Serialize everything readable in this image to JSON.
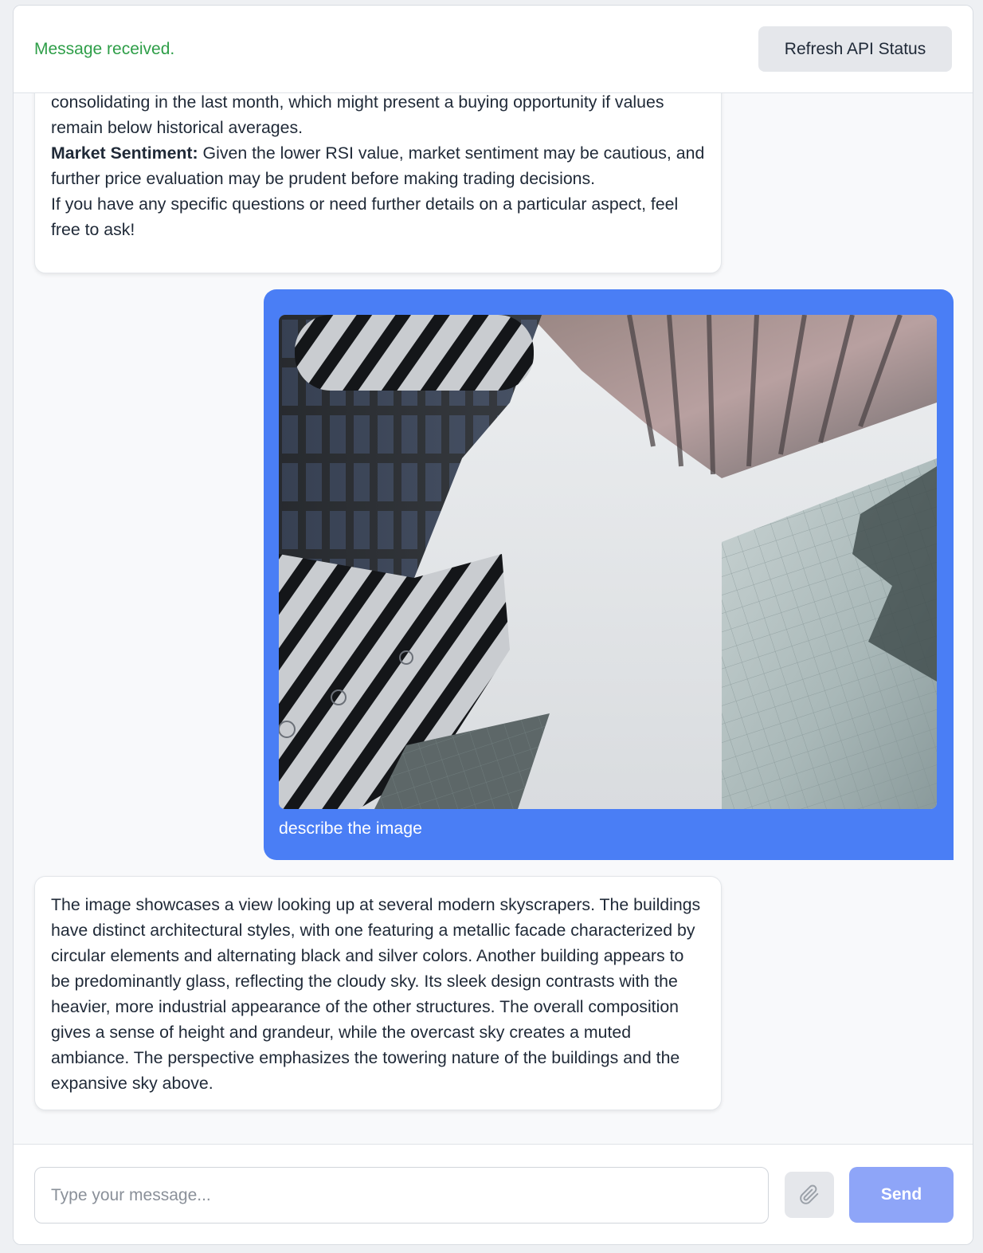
{
  "header": {
    "status": "Message received.",
    "refresh_label": "Refresh API Status"
  },
  "messages": [
    {
      "role": "assistant",
      "paragraphs": [
        {
          "text": "consolidating in the last month, which might present a buying opportunity if values remain below historical averages."
        },
        {
          "bold": "Market Sentiment:",
          "text": " Given the lower RSI value, market sentiment may be cautious, and further price evaluation may be prudent before making trading decisions."
        },
        {
          "text": "If you have any specific questions or need further details on a particular aspect, feel free to ask!"
        }
      ]
    },
    {
      "role": "user",
      "image_subject": "low-angle view of modern skyscrapers",
      "text": "describe the image"
    },
    {
      "role": "assistant",
      "text": "The image showcases a view looking up at several modern skyscrapers. The buildings have distinct architectural styles, with one featuring a metallic facade characterized by circular elements and alternating black and silver colors. Another building appears to be predominantly glass, reflecting the cloudy sky. Its sleek design contrasts with the heavier, more industrial appearance of the other structures. The overall composition gives a sense of height and grandeur, while the overcast sky creates a muted ambiance. The perspective emphasizes the towering nature of the buildings and the expansive sky above."
    }
  ],
  "composer": {
    "placeholder": "Type your message...",
    "attach_icon": "paperclip-icon",
    "send_label": "Send"
  },
  "colors": {
    "status": "#2e9e48",
    "user_bubble": "#4a7ef5",
    "send_button": "#8ea5f8"
  }
}
